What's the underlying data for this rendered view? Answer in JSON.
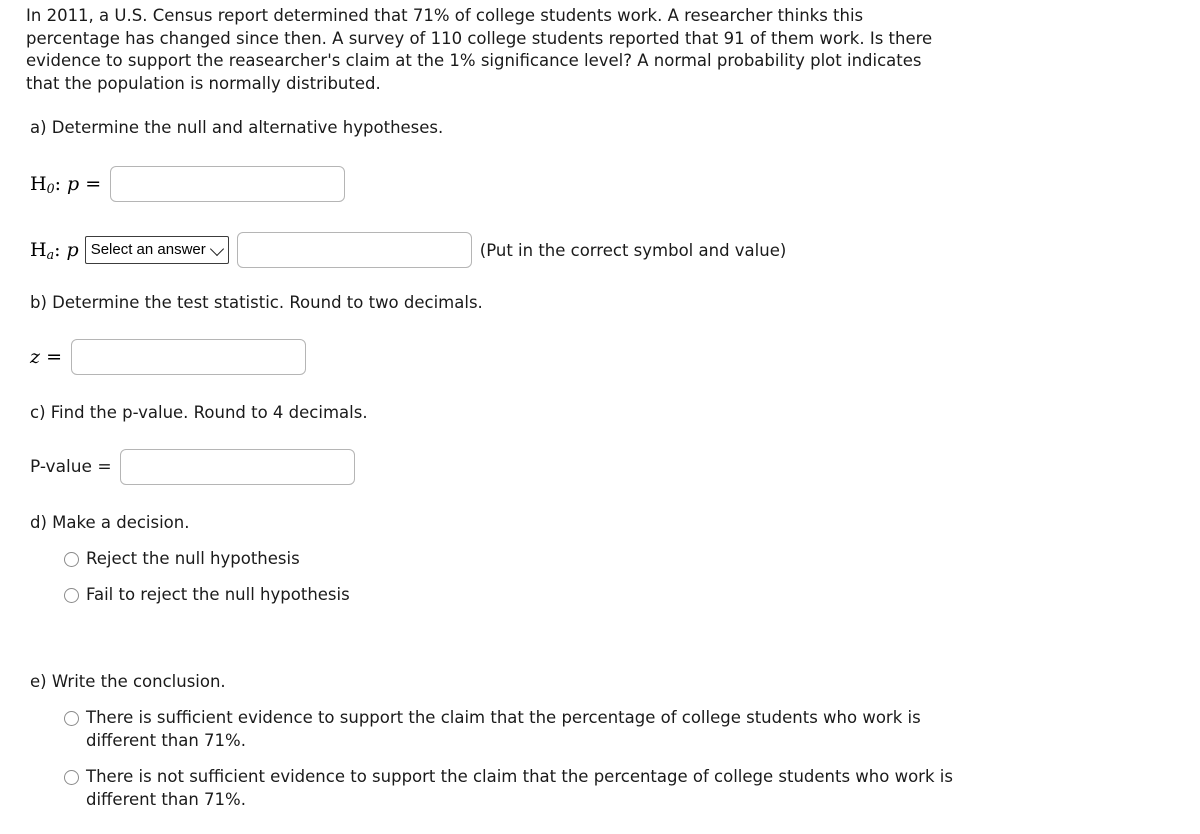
{
  "problem": {
    "statement": "In 2011, a U.S. Census report determined that 71% of college students work. A researcher thinks this percentage has changed since then. A survey of 110 college students reported that 91 of them work. Is there evidence to support the reasearcher's claim at the 1% significance level? A normal probability plot indicates that the population is normally distributed."
  },
  "parts": {
    "a": {
      "prompt": "a) Determine the null and alternative hypotheses.",
      "null_hypothesis": {
        "symbol_H": "H",
        "subscript": "0",
        "colon": ":",
        "parameter": "p",
        "operator": "=",
        "input_value": "",
        "input_placeholder": ""
      },
      "alternative_hypothesis": {
        "symbol_H": "H",
        "subscript": "a",
        "colon": ":",
        "parameter": "p",
        "select_value": "Select an answer",
        "select_options": [
          "Select an answer",
          "<",
          ">",
          "="
        ],
        "input_value": "",
        "input_placeholder": "",
        "hint": "(Put in the correct symbol and value)"
      }
    },
    "b": {
      "prompt": "b) Determine the test statistic. Round to two decimals.",
      "label_variable": "z",
      "label_operator": "=",
      "input_value": "",
      "input_placeholder": ""
    },
    "c": {
      "prompt": "c) Find the p-value. Round to 4 decimals.",
      "label": "P-value =",
      "input_value": "",
      "input_placeholder": ""
    },
    "d": {
      "prompt": "d) Make a decision.",
      "options": [
        "Reject the null hypothesis",
        "Fail to reject the null hypothesis"
      ]
    },
    "e": {
      "prompt": "e) Write the conclusion.",
      "options": [
        "There is sufficient evidence to support the claim that the percentage of college students who work is different than 71%.",
        "There is not sufficient evidence to support the claim that the percentage of college students who work is different than 71%."
      ]
    }
  },
  "colors": {
    "text": "#1a1a1a",
    "input_border": "#b5b5b5",
    "select_border": "#3c3c3c",
    "radio_border": "#8b8b8b",
    "background": "#ffffff"
  }
}
